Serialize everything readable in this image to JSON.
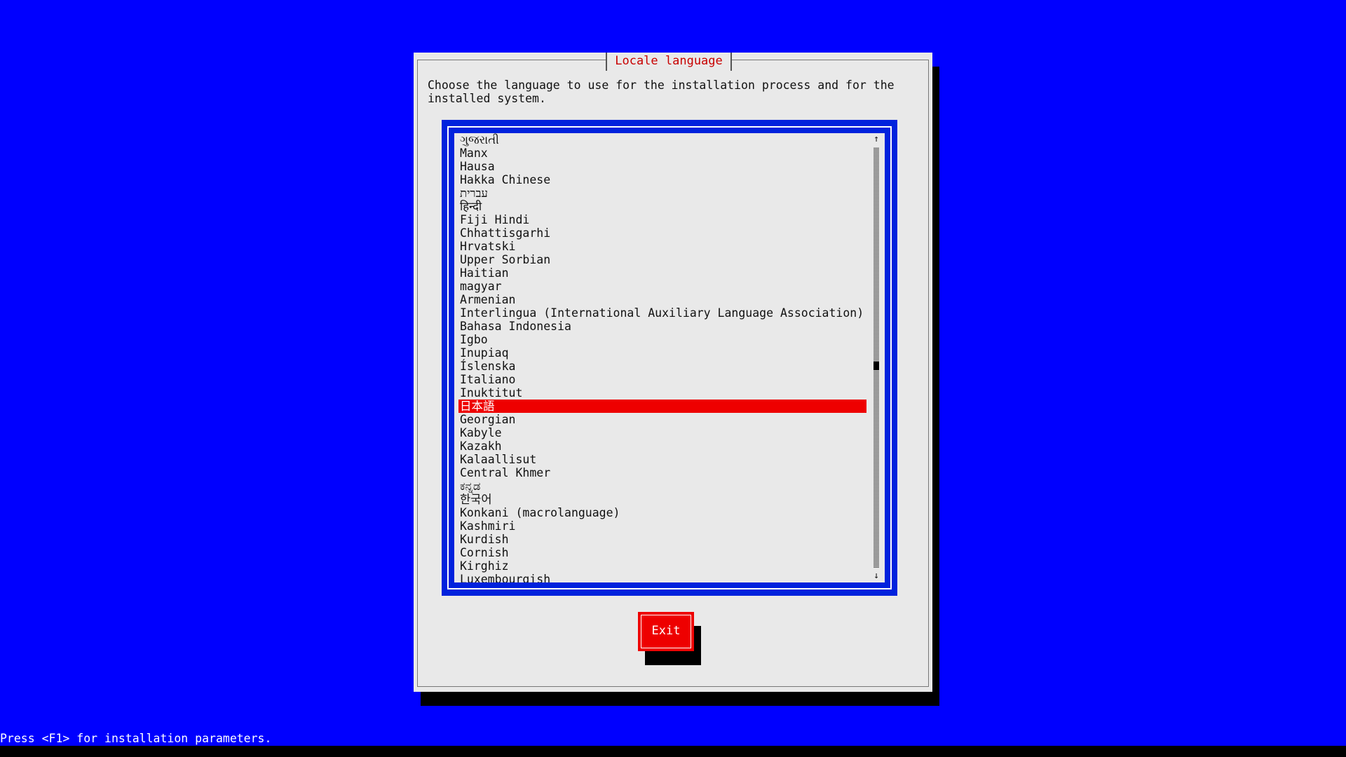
{
  "dialog": {
    "title": "Locale language",
    "prompt": "Choose the language to use for the installation process and for the\ninstalled system."
  },
  "language_list": {
    "selected_index": 20,
    "scroll_position": 0.52,
    "items": [
      "ગુજરાતી",
      "Manx",
      "Hausa",
      "Hakka Chinese",
      "עברית",
      "हिन्दी",
      "Fiji Hindi",
      "Chhattisgarhi",
      "Hrvatski",
      "Upper Sorbian",
      "Haitian",
      "magyar",
      "Armenian",
      "Interlingua (International Auxiliary Language Association)",
      "Bahasa Indonesia",
      "Igbo",
      "Inupiaq",
      "Íslenska",
      "Italiano",
      "Inuktitut",
      "日本語",
      "Georgian",
      "Kabyle",
      "Kazakh",
      "Kalaallisut",
      "Central Khmer",
      "ಕನ್ನಡ",
      "한국어",
      "Konkani (macrolanguage)",
      "Kashmiri",
      "Kurdish",
      "Cornish",
      "Kirghiz",
      "Luxembourgish"
    ],
    "scroll_up_icon": "arrow-up",
    "scroll_down_icon": "arrow-down",
    "scroll_up_glyph": "↑",
    "scroll_down_glyph": "↓"
  },
  "buttons": {
    "exit_label": "Exit"
  },
  "status_line": "Press <F1> for installation parameters.",
  "colors": {
    "background": "#0000ff",
    "dialog": "#e9e9e9",
    "accent": "#ee0000",
    "title": "#c80000"
  }
}
